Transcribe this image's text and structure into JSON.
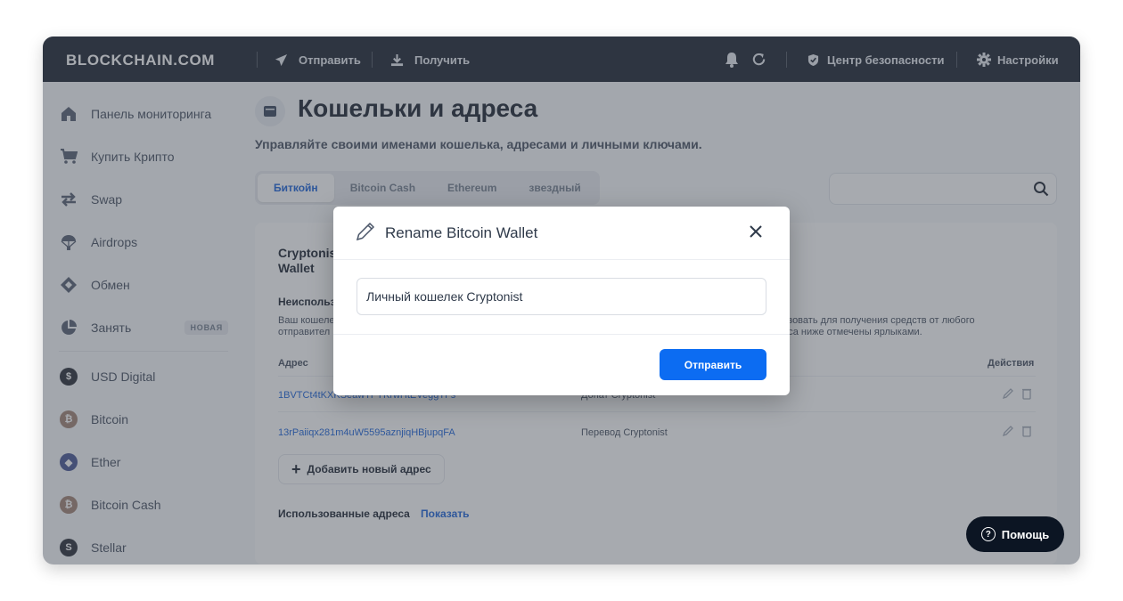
{
  "app": {
    "brand": "BLOCKCHAIN.COM"
  },
  "topbar": {
    "send": "Отправить",
    "receive": "Получить",
    "security": "Центр безопасности",
    "settings": "Настройки"
  },
  "sidebar": {
    "items": [
      {
        "label": "Панель мониторинга",
        "icon": "home-icon"
      },
      {
        "label": "Купить Крипто",
        "icon": "cart-icon"
      },
      {
        "label": "Swap",
        "icon": "swap-icon"
      },
      {
        "label": "Airdrops",
        "icon": "parachute-icon"
      },
      {
        "label": "Обмен",
        "icon": "exchange-icon"
      },
      {
        "label": "Занять",
        "icon": "pie-chart-icon",
        "badge": "НОВАЯ"
      }
    ],
    "coins": [
      {
        "label": "USD Digital",
        "symbol": "$",
        "color": "#1a1f29"
      },
      {
        "label": "Bitcoin",
        "symbol": "₿",
        "color": "#9a7b6a"
      },
      {
        "label": "Ether",
        "symbol": "◆",
        "color": "#3b4a8c"
      },
      {
        "label": "Bitcoin Cash",
        "symbol": "₿",
        "color": "#9a7b6a"
      },
      {
        "label": "Stellar",
        "symbol": "S",
        "color": "#1a1f29"
      }
    ]
  },
  "main": {
    "title": "Кошельки и адреса",
    "subtitle": "Управляйте своими именами кошелька, адресами и личными ключами.",
    "tabs": [
      "Биткойн",
      "Bitcoin Cash",
      "Ethereum",
      "звездный"
    ],
    "search_placeholder": "",
    "card": {
      "wallet_name": "Cryptonist Wallet",
      "unused_heading": "Неиспольз",
      "desc_line1": "Ваш кошеле",
      "desc_line1_tail": "льзовать для получения средств от любого",
      "desc_line2": "отправител",
      "desc_line2_tail": "реса ниже отмечены ярлыками.",
      "col_address": "Адрес",
      "col_actions": "Действия",
      "rows": [
        {
          "address": "1BVTCt4tKXKSeawTFYKrwHtEVeggTFs",
          "label": "Донат Cryptonist"
        },
        {
          "address": "13rPaiiqx281m4uW5595aznjiqHBjupqFA",
          "label": "Перевод Cryptonist"
        }
      ],
      "add_address": "Добавить новый адрес",
      "used_heading": "Использованные адреса",
      "used_link": "Показать"
    },
    "help": "Помощь"
  },
  "modal": {
    "title": "Rename Bitcoin Wallet",
    "input_value": "Личный кошелек Cryptonist",
    "submit": "Отправить"
  },
  "colors": {
    "accent": "#0c6cf2",
    "topbar": "#0c1523"
  }
}
